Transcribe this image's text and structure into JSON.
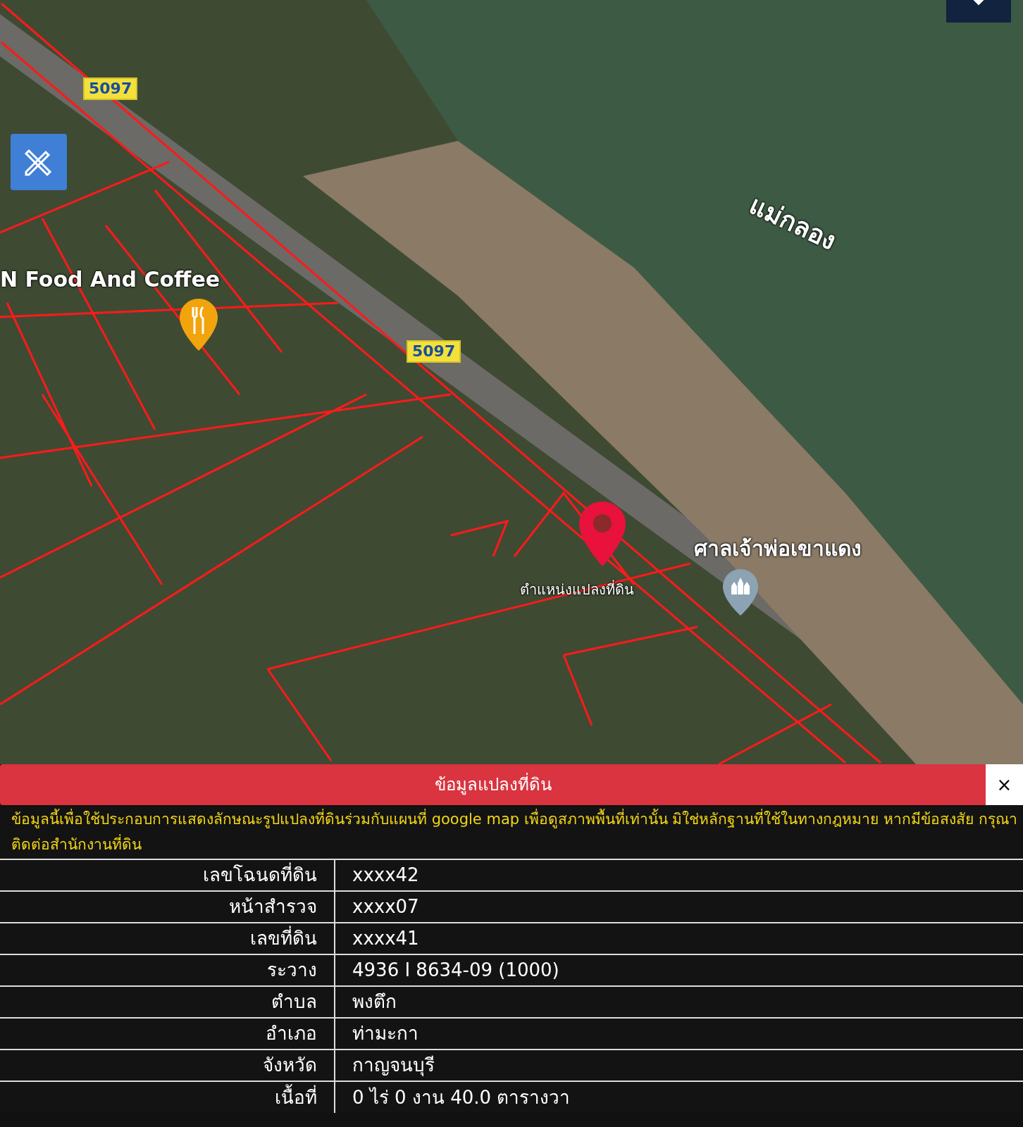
{
  "map": {
    "road_labels": [
      "5097",
      "5097"
    ],
    "place_labels": [
      {
        "kind": "restaurant",
        "text": "N Food And Coffee"
      },
      {
        "kind": "shrine",
        "text": "ศาลเจ้าพ่อเขาแดง"
      }
    ],
    "river_label": "แม่กลอง",
    "parcel_label": "ตำแหน่งแปลงที่ดิน"
  },
  "panel": {
    "title": "ข้อมูลแปลงที่ดิน",
    "close": "×",
    "notice": "ข้อมูลนี้เพื่อใช้ประกอบการแสดงลักษณะรูปแปลงที่ดินร่วมกับแผนที่ google map เพื่อดูสภาพพื้นที่เท่านั้น มิใช่หลักฐานที่ใช้ในทางกฎหมาย หากมีข้อสงสัย กรุณาติดต่อสำนักงานที่ดิน",
    "rows": [
      {
        "label": "เลขโฉนดที่ดิน",
        "value": "xxxx42"
      },
      {
        "label": "หน้าสำรวจ",
        "value": "xxxx07"
      },
      {
        "label": "เลขที่ดิน",
        "value": "xxxx41"
      },
      {
        "label": "ระวาง",
        "value": "4936 I 8634-09 (1000)"
      },
      {
        "label": "ตำบล",
        "value": "พงตึก"
      },
      {
        "label": "อำเภอ",
        "value": "ท่ามะกา"
      },
      {
        "label": "จังหวัด",
        "value": "กาญจนบุรี"
      },
      {
        "label": "เนื้อที่",
        "value": "0 ไร่ 0 งาน 40.0 ตารางวา"
      }
    ]
  }
}
